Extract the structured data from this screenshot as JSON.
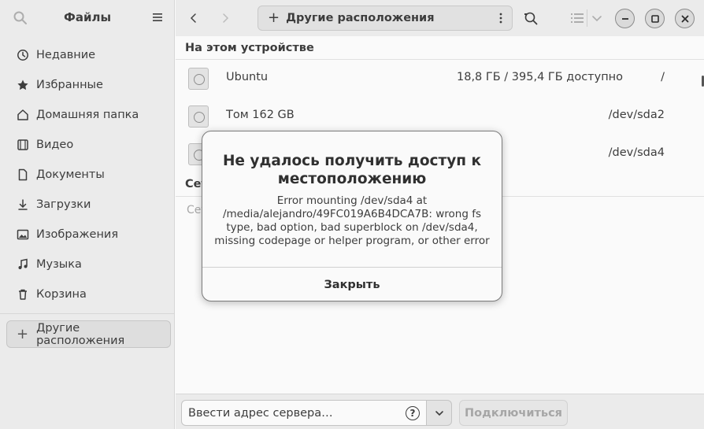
{
  "sidebar": {
    "title": "Файлы",
    "items": [
      {
        "label": "Недавние",
        "icon": "clock-icon"
      },
      {
        "label": "Избранные",
        "icon": "star-icon"
      },
      {
        "label": "Домашняя папка",
        "icon": "home-icon"
      },
      {
        "label": "Видео",
        "icon": "film-icon"
      },
      {
        "label": "Документы",
        "icon": "document-icon"
      },
      {
        "label": "Загрузки",
        "icon": "download-icon"
      },
      {
        "label": "Изображения",
        "icon": "image-icon"
      },
      {
        "label": "Музыка",
        "icon": "music-icon"
      },
      {
        "label": "Корзина",
        "icon": "trash-icon"
      }
    ],
    "other_locations": "Другие расположения"
  },
  "header": {
    "location": "Другие расположения"
  },
  "content": {
    "on_device_title": "На этом устройстве",
    "devices": [
      {
        "name": "Ubuntu",
        "size": "18,8 ГБ / 395,4 ГБ доступно",
        "path": "/"
      },
      {
        "name": "Том 162 GB",
        "size": "",
        "path": "/dev/sda2"
      },
      {
        "name": "",
        "size": "",
        "path": "/dev/sda4"
      }
    ],
    "networks_title_partial": "Сет",
    "networks_hint_partial": "Сет"
  },
  "bottom": {
    "server_placeholder": "Ввести адрес сервера…",
    "connect_label": "Подключиться"
  },
  "dialog": {
    "title": "Не удалось получить доступ к местоположению",
    "body": "Error mounting /dev/sda4 at /media/alejandro/49FC019A6B4DCA7B: wrong fs type, bad option, bad superblock on /dev/sda4, missing codepage or helper program, or other error",
    "close_label": "Закрыть"
  }
}
